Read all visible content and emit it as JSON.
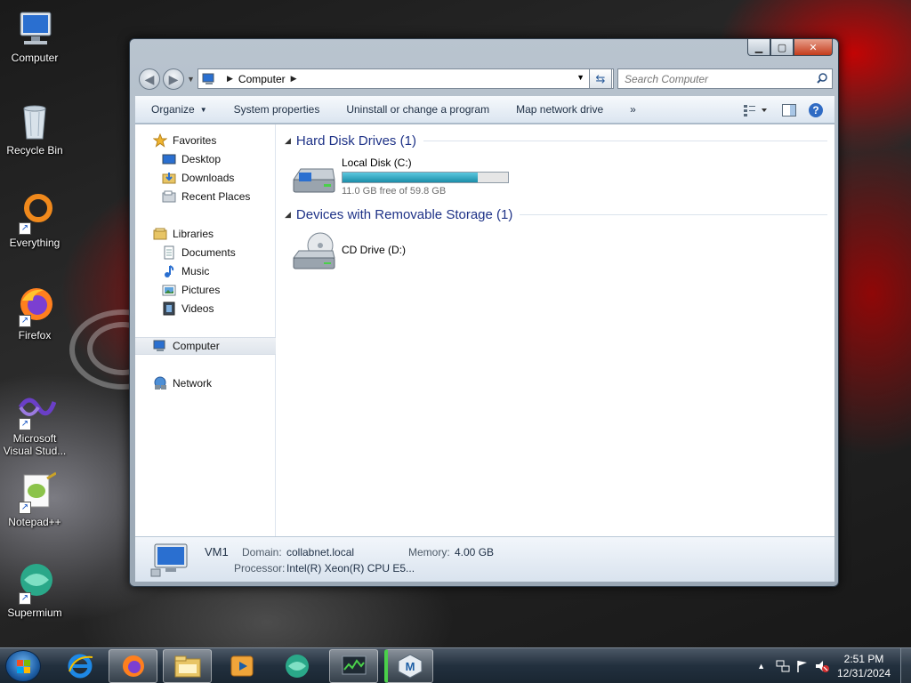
{
  "desktop": {
    "icons": [
      {
        "label": "Computer",
        "icon": "computer-icon"
      },
      {
        "label": "Recycle Bin",
        "icon": "recycle-bin-icon"
      },
      {
        "label": "Everything",
        "icon": "everything-search-icon"
      },
      {
        "label": "Firefox",
        "icon": "firefox-icon"
      },
      {
        "label": "Microsoft Visual Stud...",
        "icon": "visual-studio-icon"
      },
      {
        "label": "Notepad++",
        "icon": "notepad-plus-plus-icon"
      },
      {
        "label": "Supermium",
        "icon": "supermium-icon"
      }
    ]
  },
  "window": {
    "address": {
      "location": "Computer"
    },
    "search": {
      "placeholder": "Search Computer"
    },
    "toolbar": {
      "organize": "Organize",
      "system_properties": "System properties",
      "uninstall": "Uninstall or change a program",
      "map_drive": "Map network drive",
      "more": "»"
    },
    "nav": {
      "favorites": "Favorites",
      "desktop": "Desktop",
      "downloads": "Downloads",
      "recent_places": "Recent Places",
      "libraries": "Libraries",
      "documents": "Documents",
      "music": "Music",
      "pictures": "Pictures",
      "videos": "Videos",
      "computer": "Computer",
      "network": "Network"
    },
    "groups": {
      "hdd": "Hard Disk Drives (1)",
      "removable": "Devices with Removable Storage (1)"
    },
    "drives": {
      "local": {
        "name": "Local Disk (C:)",
        "free_text": "11.0 GB free of 59.8 GB",
        "used_fraction": 0.816
      },
      "cd": {
        "name": "CD Drive (D:)"
      }
    },
    "details": {
      "name": "VM1",
      "domain_label": "Domain:",
      "domain": "collabnet.local",
      "memory_label": "Memory:",
      "memory": "4.00 GB",
      "processor_label": "Processor:",
      "processor": "Intel(R) Xeon(R) CPU E5..."
    }
  },
  "taskbar": {
    "time": "2:51 PM",
    "date": "12/31/2024"
  }
}
